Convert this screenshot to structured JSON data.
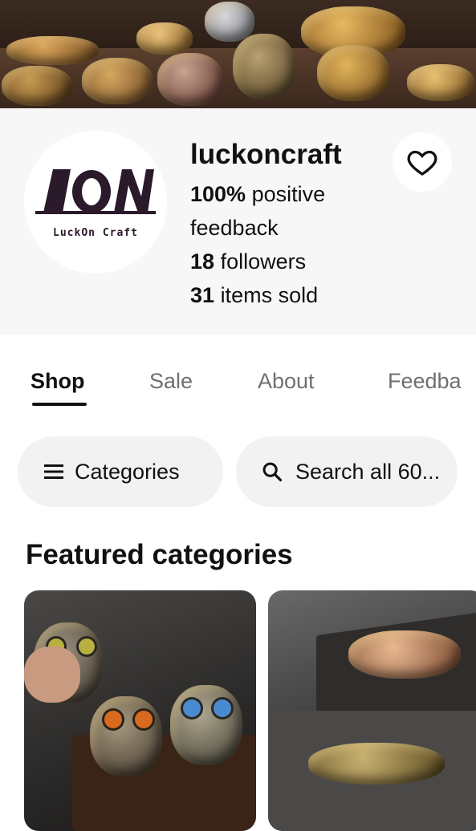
{
  "store": {
    "name": "luckoncraft",
    "logo_text": "LuckOn Craft",
    "feedback_percent": "100%",
    "feedback_label_1": "positive",
    "feedback_label_2": "feedback",
    "followers_count": "18",
    "followers_label": "followers",
    "sold_count": "31",
    "sold_label": "items sold"
  },
  "tabs": [
    "Shop",
    "Sale",
    "About",
    "Feedba"
  ],
  "controls": {
    "categories_label": "Categories",
    "search_label": "Search all 60..."
  },
  "featured": {
    "title": "Featured categories"
  },
  "icons": [
    "heart-icon",
    "menu-icon",
    "search-icon"
  ],
  "colors": {
    "accent": "#111111",
    "tab_inactive": "#707070",
    "pill_bg": "#f2f2f2"
  }
}
